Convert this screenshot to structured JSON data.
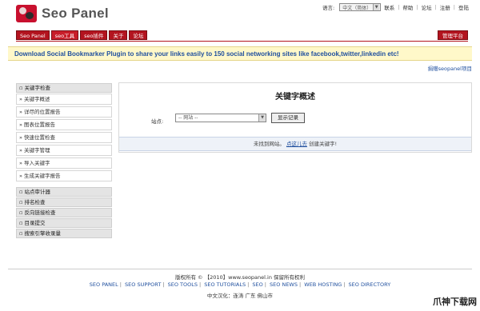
{
  "header": {
    "logo_text": "Seo Panel",
    "lang_label": "语言:",
    "lang_value": "中文（简体）",
    "links": [
      "联系",
      "帮助",
      "论坛",
      "注册",
      "登陆"
    ]
  },
  "nav": {
    "tabs": [
      "Seo Panel",
      "seo工具",
      "seo插件",
      "关于",
      "论坛"
    ],
    "admin": "管理平台"
  },
  "banner": {
    "text": "Download Social Bookmarker Plugin to share your links easily to 150 social networking sites like facebook,twitter,linkedin etc!",
    "donate": "捐赠seopanel项目"
  },
  "sidebar": {
    "group1_title": "关键字检查",
    "group1_items": [
      "关键字概述",
      "详尽的位置报告",
      "图表位置报告",
      "快速位置检查",
      "关键字管理",
      "导入关键字",
      "生成关键字报告"
    ],
    "groups": [
      "站点审计器",
      "排名检查",
      "反向链接检查",
      "目录提交",
      "搜索引擎收录量"
    ]
  },
  "main": {
    "title": "关键字概述",
    "site_label": "站点:",
    "site_value": "-- 网站 --",
    "show_button": "显示记录",
    "info_text": "未找到网站。",
    "info_link": "点这儿去",
    "info_tail": "创建关键字!"
  },
  "footer": {
    "copyright": "版权所有 © 【2010】www.seopanel.in 保留所有权利",
    "links": [
      "SEO PANEL",
      "SEO SUPPORT",
      "SEO TOOLS",
      "SEO TUTORIALS",
      "SEO",
      "SEO NEWS",
      "WEB HOSTING",
      "SEO DIRECTORY"
    ],
    "powered": "中文汉化：连涛 广东 佛山市",
    "watermark": "爪神下载网"
  }
}
